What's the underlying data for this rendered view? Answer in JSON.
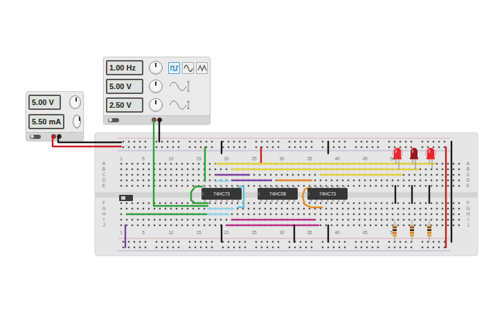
{
  "power_supply": {
    "readings": [
      "5.00 V",
      "5.50 mA"
    ]
  },
  "function_generator": {
    "readings": [
      "1.00 Hz",
      "5.00 V",
      "2.50 V"
    ],
    "waveforms": [
      {
        "kind": "square",
        "selected": true
      },
      {
        "kind": "sine",
        "selected": false
      },
      {
        "kind": "triangle",
        "selected": false
      }
    ]
  },
  "breadboard": {
    "row_labels_top": [
      "A",
      "B",
      "C",
      "D",
      "E"
    ],
    "row_labels_bottom": [
      "F",
      "G",
      "H",
      "I",
      "J"
    ],
    "column_labels": [
      "1",
      "5",
      "10",
      "15",
      "20",
      "25",
      "30",
      "35",
      "40",
      "45",
      "50"
    ]
  },
  "chips": [
    {
      "label": "74HC73"
    },
    {
      "label": "74HC08"
    },
    {
      "label": "74HC73"
    }
  ],
  "leds": [
    {
      "lit": true
    },
    {
      "lit": false
    },
    {
      "lit": true
    }
  ],
  "wires": [
    {
      "color": "#1a1a1a"
    },
    {
      "color": "#cc1a1a"
    },
    {
      "color": "#2e9e3a"
    },
    {
      "color": "#1a1a1a"
    },
    {
      "color": "#2e9e3a"
    },
    {
      "color": "#2e9e3a"
    },
    {
      "color": "#2e9e3a"
    },
    {
      "color": "#1a1a1a"
    },
    {
      "color": "#cc1a1a"
    },
    {
      "color": "#1a1a1a"
    },
    {
      "color": "#e3d23a"
    },
    {
      "color": "#e3d23a"
    },
    {
      "color": "#e3d23a"
    },
    {
      "color": "#7b3fa0"
    },
    {
      "color": "#7b3fa0"
    },
    {
      "color": "#e08a1e"
    },
    {
      "color": "#8fd3ea"
    },
    {
      "color": "#5bc0de"
    },
    {
      "color": "#8fd3ea"
    },
    {
      "color": "#8fd3ea"
    },
    {
      "color": "#e08a1e"
    },
    {
      "color": "#c02a8a"
    },
    {
      "color": "#c02a8a"
    },
    {
      "color": "#7b3fa0"
    },
    {
      "color": "#1a1a1a"
    },
    {
      "color": "#1a1a1a"
    },
    {
      "color": "#1a1a1a"
    },
    {
      "color": "#1a1a1a"
    },
    {
      "color": "#1a1a1a"
    },
    {
      "color": "#1a1a1a"
    },
    {
      "color": "#cc1a1a"
    },
    {
      "color": "#1a1a1a"
    }
  ]
}
